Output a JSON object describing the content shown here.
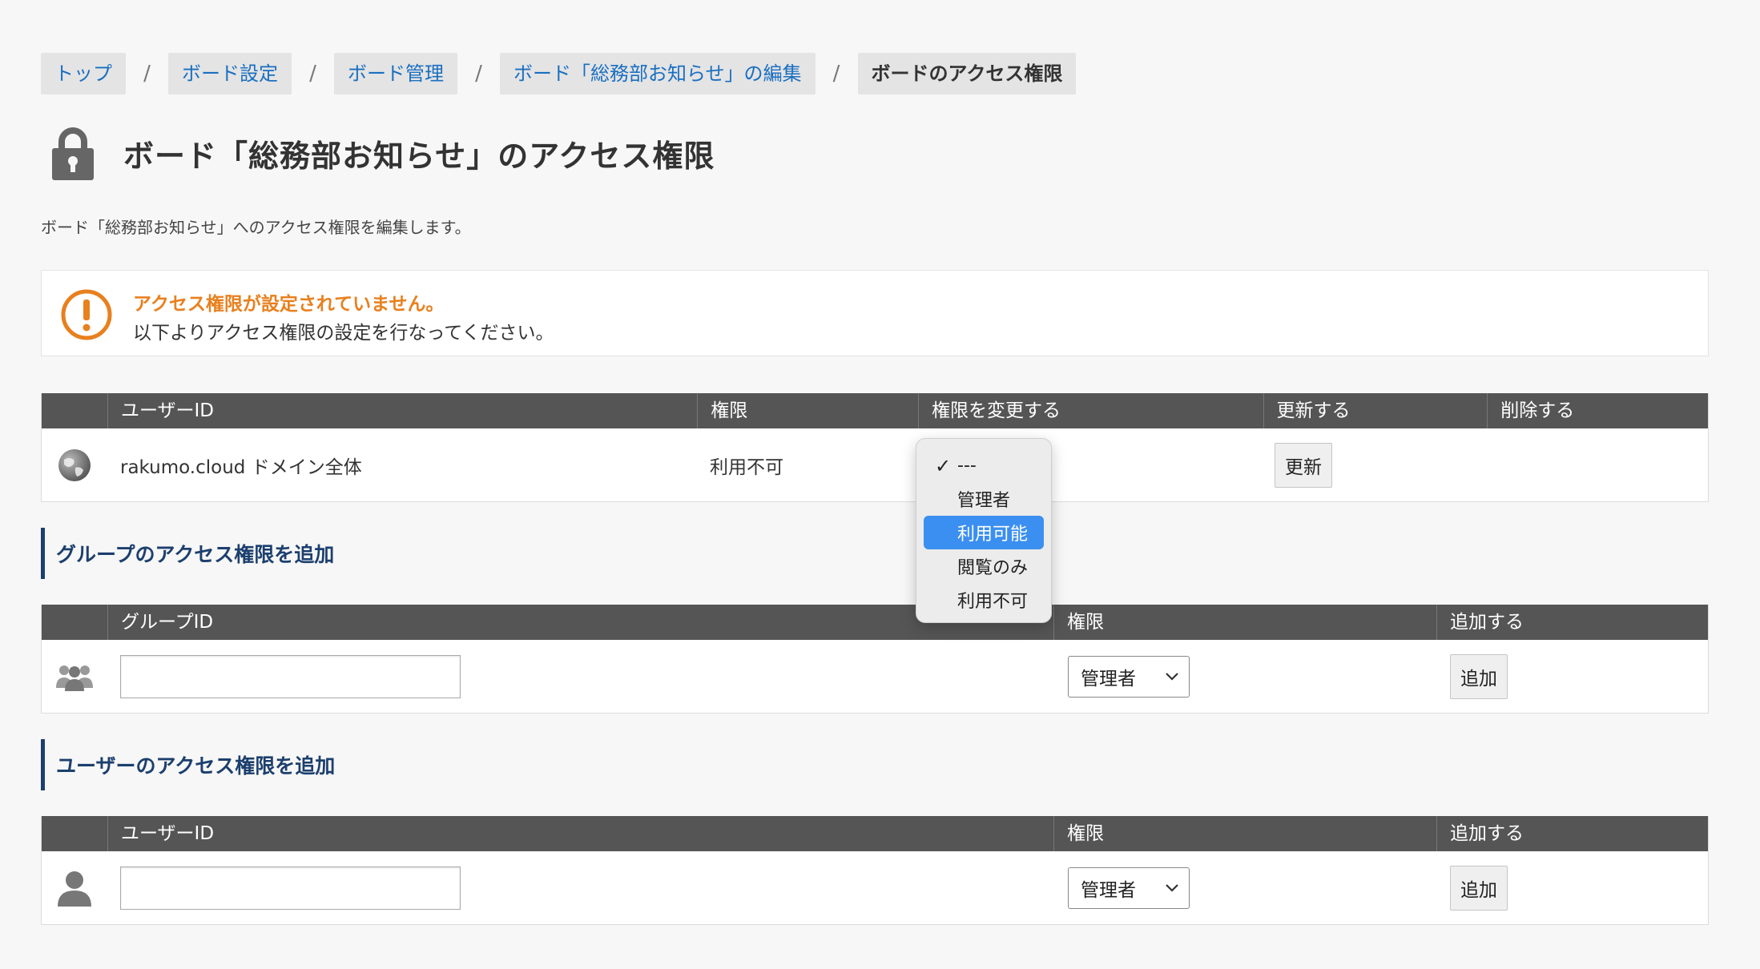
{
  "breadcrumb": {
    "items": [
      "トップ",
      "ボード設定",
      "ボード管理",
      "ボード「総務部お知らせ」の編集"
    ],
    "current": "ボードのアクセス権限",
    "separator": "/"
  },
  "page": {
    "title": "ボード「総務部お知らせ」のアクセス権限",
    "description": "ボード「総務部お知らせ」へのアクセス権限を編集します。"
  },
  "notice": {
    "title": "アクセス権限が設定されていません。",
    "text": "以下よりアクセス権限の設定を行なってください。"
  },
  "permissions_table": {
    "headers": [
      "ユーザーID",
      "権限",
      "権限を変更する",
      "更新する",
      "削除する"
    ],
    "rows": [
      {
        "user_id": "rakumo.cloud ドメイン全体",
        "permission": "利用不可",
        "update_button": "更新"
      }
    ]
  },
  "dropdown": {
    "options": [
      "---",
      "管理者",
      "利用可能",
      "閲覧のみ",
      "利用不可"
    ],
    "checked": "---",
    "highlighted": "利用可能"
  },
  "group_section": {
    "heading": "グループのアクセス権限を追加",
    "headers": [
      "グループID",
      "権限",
      "追加する"
    ],
    "input_value": "",
    "select_value": "管理者",
    "add_button": "追加"
  },
  "user_section": {
    "heading": "ユーザーのアクセス権限を追加",
    "headers": [
      "ユーザーID",
      "権限",
      "追加する"
    ],
    "input_value": "",
    "select_value": "管理者",
    "add_button": "追加"
  },
  "colors": {
    "link": "#1a6fc0",
    "notice_accent": "#e8801e",
    "section_heading": "#1c3f6e",
    "table_header": "#555555",
    "dropdown_highlight": "#3b8ff0"
  },
  "icons": {
    "title": "lock-icon",
    "notice": "exclamation-circle-icon",
    "domain_row": "globe-icon",
    "group_row": "group-icon",
    "user_row": "user-icon",
    "select": "chevron-down-icon",
    "dropdown_check": "checkmark-icon"
  }
}
